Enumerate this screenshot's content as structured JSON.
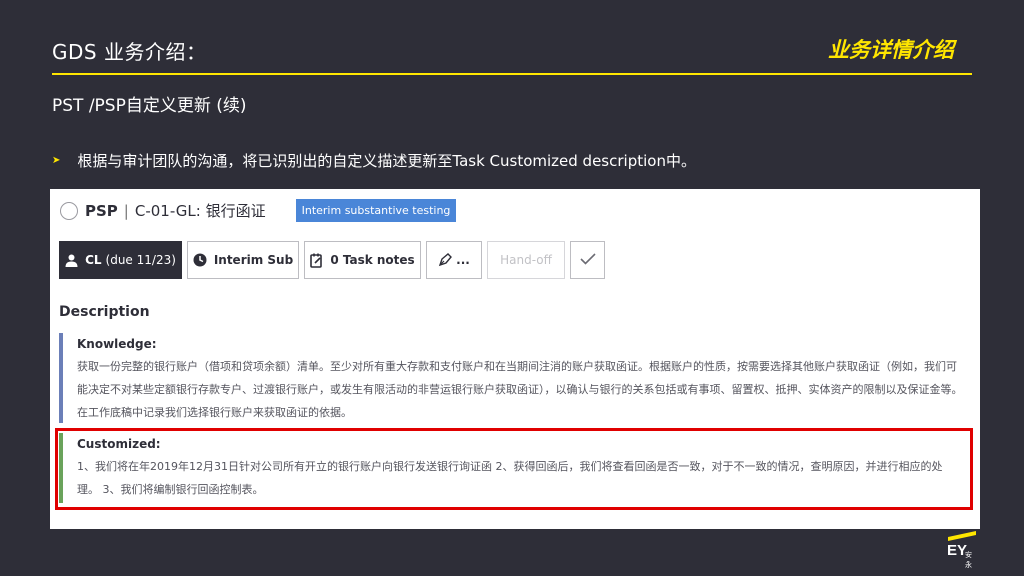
{
  "slide": {
    "title": "GDS 业务介绍：",
    "section_tag": "业务详情介绍",
    "subtitle": "PST /PSP自定义更新 (续)",
    "bullet": "根据与审计团队的沟通，将已识别出的自定义描述更新至Task Customized description中。",
    "logo": {
      "mark": "EY",
      "chinese": "安永"
    }
  },
  "task": {
    "code": "PSP",
    "separator": "|",
    "name": "C-01-GL: 银行函证",
    "phase_badge": "Interim substantive testing",
    "toolbar": {
      "assignee_label": "CL",
      "assignee_due": "(due 11/23)",
      "phase_label": "Interim Sub",
      "notes_label": "0 Task notes",
      "more_label": "...",
      "handoff_label": "Hand-off"
    },
    "description_label": "Description",
    "knowledge": {
      "heading": "Knowledge:",
      "text": "获取一份完整的银行账户（借项和贷项余额）清单。至少对所有重大存款和支付账户和在当期间注消的账户获取函证。根据账户的性质，按需要选择其他账户获取函证（例如，我们可能决定不对某些定额银行存款专户、过渡银行账户，或发生有限活动的非营运银行账户获取函证），以确认与银行的关系包括或有事项、留置权、抵押、实体资产的限制以及保证金等。在工作底稿中记录我们选择银行账户来获取函证的依据。"
    },
    "customized": {
      "heading": "Customized:",
      "text": "1、我们将在年2019年12月31日针对公司所有开立的银行账户向银行发送银行询证函 2、获得回函后，我们将查看回函是否一致，对于不一致的情况，查明原因，并进行相应的处理。 3、我们将编制银行回函控制表。"
    }
  },
  "colors": {
    "background": "#2e2e38",
    "accent_yellow": "#ffe600",
    "badge_blue": "#4a86d8",
    "highlight_red": "#e00000",
    "knowledge_bar": "#6b7fb8",
    "customized_bar": "#6aa35b"
  },
  "icons": [
    "person-icon",
    "clock-icon",
    "notes-icon",
    "pen-icon",
    "checkmark-icon",
    "radio-circle-icon",
    "arrow-bullet-icon"
  ]
}
